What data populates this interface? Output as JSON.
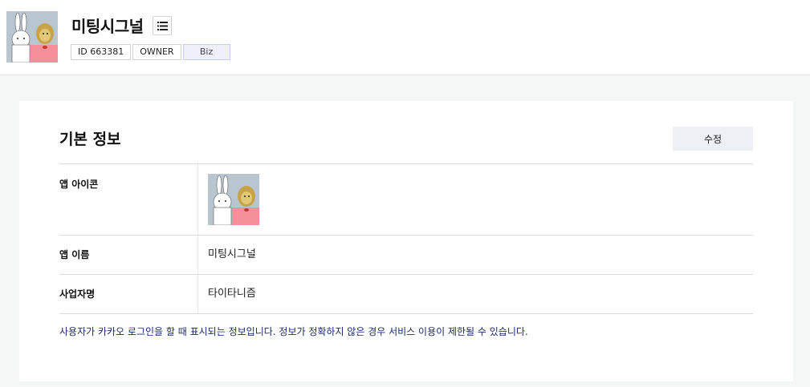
{
  "header": {
    "title": "미팅시그널",
    "avatar_icon": "app-avatar-rabbit-lion",
    "menu_icon": "list-icon",
    "badges": [
      "ID 663381",
      "OWNER",
      "Biz"
    ]
  },
  "basic_info": {
    "title": "기본 정보",
    "edit_label": "수정",
    "rows": {
      "icon_label": "앱 아이콘",
      "name_label": "앱 이름",
      "name_value": "미팅시그널",
      "company_label": "사업자명",
      "company_value": "타이타니즘"
    },
    "notice": "사용자가 카카오 로그인을 할 때 표시되는 정보입니다. 정보가 정확하지 않은 경우 서비스 이용이 제한될 수 있습니다."
  },
  "colors": {
    "notice_text": "#1d2a6e",
    "biz_badge_bg": "#eef0fb",
    "edit_button_bg": "#eff0f6"
  }
}
